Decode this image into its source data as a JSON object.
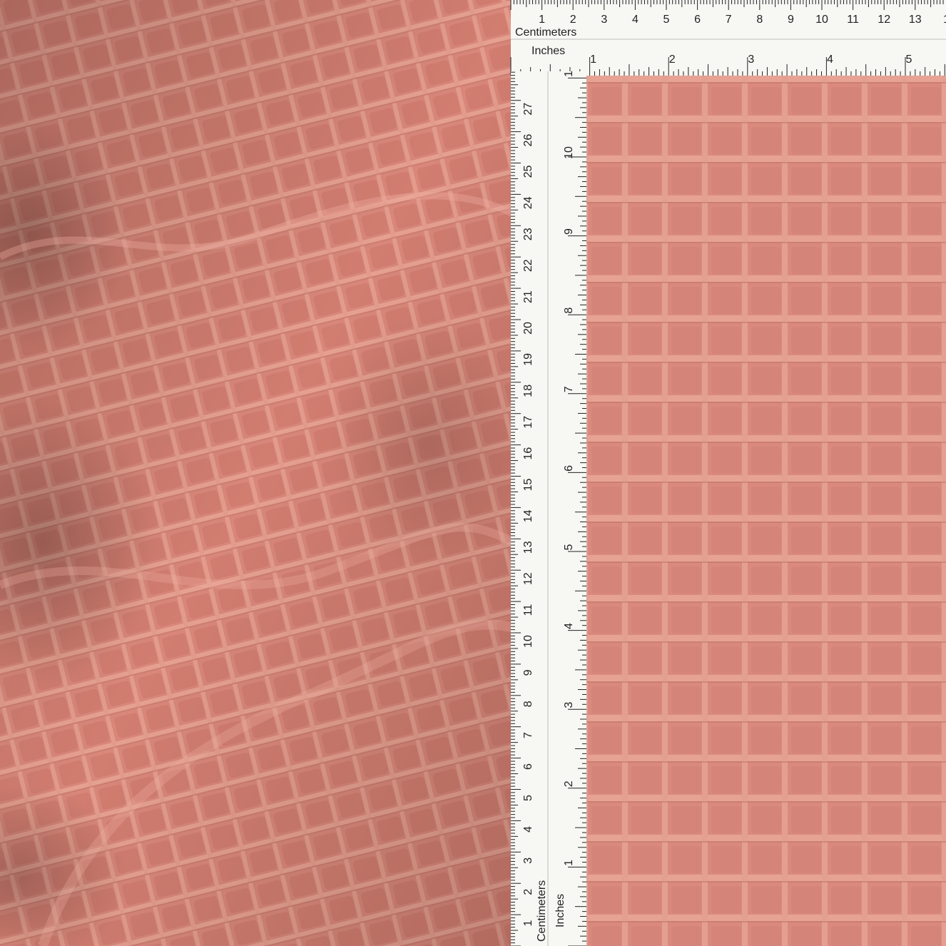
{
  "colors": {
    "fabric_base": "#d8877a",
    "fabric_light": "#e8a192",
    "fabric_dark": "#b86a5f",
    "ruler_bg": "#f7f7f4",
    "ruler_ink": "#222222"
  },
  "top_ruler": {
    "cm_label": "Centimeters",
    "in_label": "Inches",
    "cm_numbers": [
      "1",
      "2",
      "3",
      "4",
      "5",
      "6",
      "7",
      "8",
      "9",
      "10",
      "11",
      "12",
      "13",
      "1"
    ],
    "in_numbers": [
      "1",
      "2",
      "3",
      "4",
      "5"
    ]
  },
  "side_ruler": {
    "cm_label": "Centimeters",
    "in_label": "Inches",
    "cm_numbers": [
      "1",
      "2",
      "3",
      "4",
      "5",
      "6",
      "7",
      "8",
      "9",
      "10",
      "11",
      "12",
      "13",
      "14",
      "15",
      "16",
      "17",
      "18",
      "19",
      "20",
      "21",
      "22",
      "23",
      "24",
      "25",
      "26",
      "27",
      "2"
    ],
    "in_numbers": [
      "1",
      "2",
      "3",
      "4",
      "5",
      "6",
      "7",
      "8",
      "9",
      "10",
      "1"
    ]
  }
}
